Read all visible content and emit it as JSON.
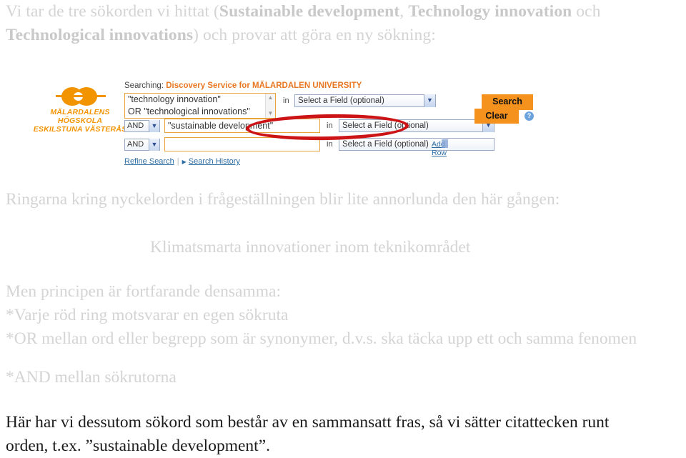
{
  "slide": {
    "intro": {
      "part1": "Vi tar de tre sökorden vi hittat (",
      "bold1": "Sustainable development",
      "part2": ", ",
      "bold2": "Technology innovation",
      "part3": " och ",
      "bold3": "Technological innovations",
      "part4": ") och provar att göra en ny sökning:"
    },
    "paragraphs": {
      "ringarna": "Ringarna kring nyckelorden i frågeställningen blir lite annorlunda den här gången:",
      "klimat": "Klimatsmarta innovationer inom teknikområdet",
      "princip_line1": "Men principen är fortfarande densamma:",
      "princip_line2": "*Varje röd ring motsvarar en egen sökruta",
      "princip_line3": "*OR mellan ord eller begrepp som är synonymer, d.v.s. ska täcka upp ett och samma fenomen",
      "and_line": "*AND mellan sökrutorna",
      "slut": "Här har vi dessutom sökord som består av en sammansatt fras, så vi sätter citattecken runt orden, t.ex. ”sustainable development”."
    }
  },
  "screenshot": {
    "logo": {
      "line1": "MÄLARDALENS HÖGSKOLA",
      "line2": "ESKILSTUNA VÄSTERÅS",
      "brand_color": "#F29400"
    },
    "searching": {
      "label": "Searching:",
      "value": "Discovery Service for MÄLARDALEN UNIVERSITY"
    },
    "rows": [
      {
        "boolean": "",
        "term": "\"technology innovation\"\nOR \"technological innovations\"",
        "in_label": "in",
        "field": "Select a Field (optional)"
      },
      {
        "boolean": "AND",
        "term": "\"sustainable development\"",
        "in_label": "in",
        "field": "Select a Field (optional)"
      },
      {
        "boolean": "AND",
        "term": "",
        "in_label": "in",
        "field": "Select a Field (optional)"
      }
    ],
    "add_row": "Add Row",
    "links": {
      "refine_search": "Refine Search",
      "separator": "|",
      "search_history": "Search History"
    },
    "buttons": {
      "search": "Search",
      "clear": "Clear",
      "help": "?"
    },
    "annotation": {
      "ring_color": "#CC1417",
      "ring_target": "\"sustainable development\""
    }
  }
}
